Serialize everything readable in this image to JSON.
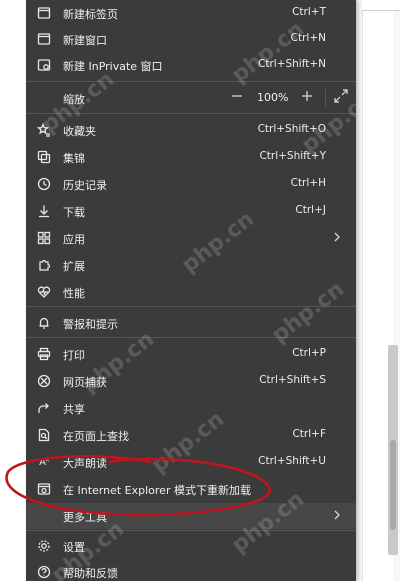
{
  "menu": {
    "items": [
      {
        "id": "new-tab",
        "icon": "new-tab-icon",
        "label": "新建标签页",
        "shortcut": "Ctrl+T"
      },
      {
        "id": "new-window",
        "icon": "new-window-icon",
        "label": "新建窗口",
        "shortcut": "Ctrl+N"
      },
      {
        "id": "new-inprivate",
        "icon": "inprivate-icon",
        "label": "新建 InPrivate 窗口",
        "shortcut": "Ctrl+Shift+N"
      },
      {
        "id": "favorites",
        "icon": "favorites-icon",
        "label": "收藏夹",
        "shortcut": "Ctrl+Shift+O"
      },
      {
        "id": "collections",
        "icon": "collections-icon",
        "label": "集锦",
        "shortcut": "Ctrl+Shift+Y"
      },
      {
        "id": "history",
        "icon": "history-icon",
        "label": "历史记录",
        "shortcut": "Ctrl+H"
      },
      {
        "id": "downloads",
        "icon": "download-icon",
        "label": "下载",
        "shortcut": "Ctrl+J"
      },
      {
        "id": "apps",
        "icon": "apps-icon",
        "label": "应用",
        "shortcut": ""
      },
      {
        "id": "extensions",
        "icon": "extensions-icon",
        "label": "扩展",
        "shortcut": ""
      },
      {
        "id": "performance",
        "icon": "performance-icon",
        "label": "性能",
        "shortcut": ""
      },
      {
        "id": "alerts",
        "icon": "bell-icon",
        "label": "警报和提示",
        "shortcut": ""
      },
      {
        "id": "print",
        "icon": "print-icon",
        "label": "打印",
        "shortcut": "Ctrl+P"
      },
      {
        "id": "web-capture",
        "icon": "web-capture-icon",
        "label": "网页捕获",
        "shortcut": "Ctrl+Shift+S"
      },
      {
        "id": "share",
        "icon": "share-icon",
        "label": "共享",
        "shortcut": ""
      },
      {
        "id": "find",
        "icon": "find-icon",
        "label": "在页面上查找",
        "shortcut": "Ctrl+F"
      },
      {
        "id": "read-aloud",
        "icon": "read-aloud-icon",
        "label": "大声朗读",
        "shortcut": "Ctrl+Shift+U"
      },
      {
        "id": "ie-mode",
        "icon": "ie-mode-icon",
        "label": "在 Internet Explorer 模式下重新加载",
        "shortcut": ""
      },
      {
        "id": "more-tools",
        "icon": "",
        "label": "更多工具",
        "shortcut": ""
      },
      {
        "id": "settings",
        "icon": "gear-icon",
        "label": "设置",
        "shortcut": ""
      },
      {
        "id": "help",
        "icon": "help-icon",
        "label": "帮助和反馈",
        "shortcut": ""
      }
    ],
    "zoom": {
      "label": "缩放",
      "value": "100%",
      "minus": "−",
      "plus": "+"
    }
  },
  "watermark": "php.cn",
  "colors": {
    "menu_bg": "#3b3b3b",
    "text": "#f0f0f0",
    "annotation": "#c0141e"
  }
}
